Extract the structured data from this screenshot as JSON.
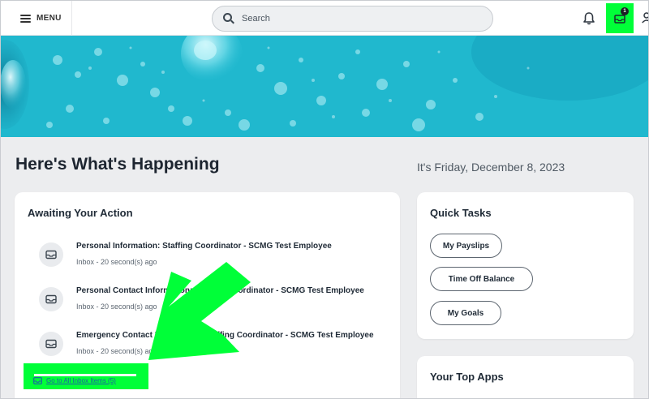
{
  "header": {
    "menu_label": "MENU",
    "search_placeholder": "Search",
    "inbox_badge_count": "1",
    "icons": [
      "hamburger-icon",
      "search-icon",
      "bell-icon",
      "inbox-icon",
      "user-icon"
    ]
  },
  "colors": {
    "highlight": "#00ff38",
    "banner": "#1ab8cf",
    "link": "#1b5ca8"
  },
  "main": {
    "title": "Here's What's Happening",
    "date": "It's Friday, December 8, 2023"
  },
  "awaiting": {
    "title": "Awaiting Your Action",
    "items": [
      {
        "title": "Personal Information: Staffing Coordinator - SCMG Test Employee",
        "meta": "Inbox - 20 second(s) ago"
      },
      {
        "title": "Personal Contact Information: Staffing Coordinator - SCMG Test Employee",
        "meta": "Inbox - 20 second(s) ago"
      },
      {
        "title": "Emergency Contact Information: Staffing Coordinator - SCMG Test Employee",
        "meta": "Inbox - 20 second(s) ago"
      }
    ],
    "link_label": "Go to All Inbox Items (5)"
  },
  "quick_tasks": {
    "title": "Quick Tasks",
    "buttons": [
      {
        "label": "My Payslips"
      },
      {
        "label": "Time Off Balance"
      },
      {
        "label": "My Goals"
      }
    ]
  },
  "top_apps": {
    "title": "Your Top Apps"
  }
}
